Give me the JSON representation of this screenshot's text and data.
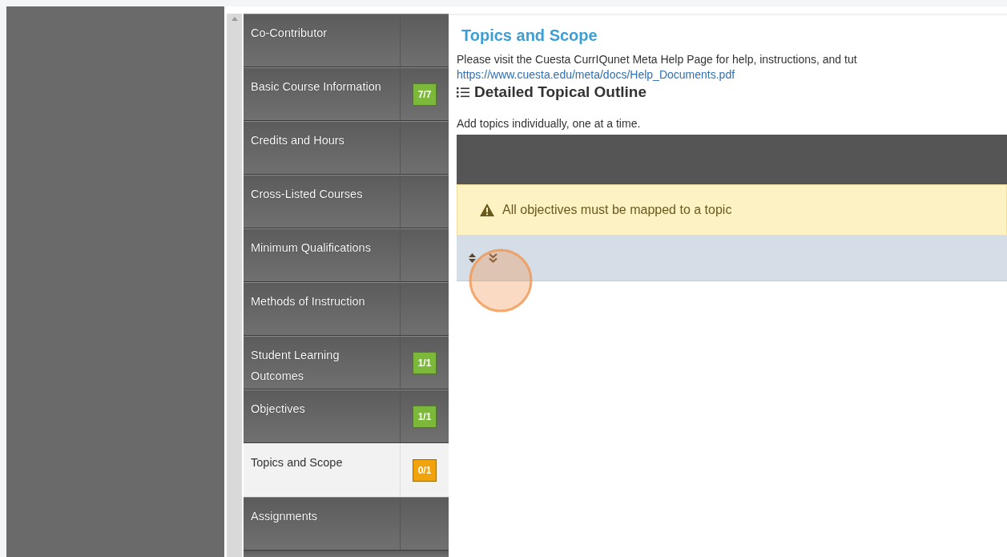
{
  "sidebar": {
    "items": [
      {
        "label": "Co-Contributor",
        "selected": false
      },
      {
        "label": "Basic Course Information",
        "selected": false,
        "badge": {
          "text": "7/7",
          "color": "#7cb83a"
        }
      },
      {
        "label": "Credits and Hours",
        "selected": false
      },
      {
        "label": "Cross-Listed Courses",
        "selected": false
      },
      {
        "label": "Minimum Qualifications",
        "selected": false
      },
      {
        "label": "Methods of Instruction",
        "selected": false
      },
      {
        "label": "Student Learning Outcomes",
        "selected": false,
        "badge": {
          "text": "1/1",
          "color": "#7cb83a"
        }
      },
      {
        "label": "Objectives",
        "selected": false,
        "badge": {
          "text": "1/1",
          "color": "#7cb83a"
        }
      },
      {
        "label": "Topics and Scope",
        "selected": true,
        "badge": {
          "text": "0/1",
          "color": "#f0a30a"
        }
      },
      {
        "label": "Assignments",
        "selected": false
      }
    ]
  },
  "main": {
    "title": "Topics and Scope",
    "help_text": "Please visit the Cuesta CurrIQunet Meta Help Page for help, instructions, and tut",
    "help_link": "https://www.cuesta.edu/meta/docs/Help_Documents.pdf",
    "section_heading": "Detailed Topical Outline",
    "instruction": "Add topics individually, one at a time.",
    "warning": "All objectives must be mapped to a topic"
  }
}
